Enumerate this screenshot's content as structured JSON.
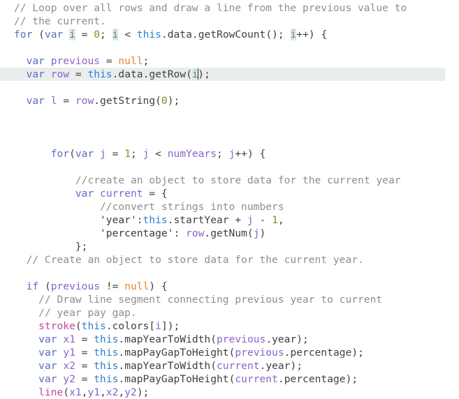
{
  "editor": {
    "name": "code-editor",
    "language": "javascript",
    "background_color": "#ffffff",
    "active_line_color": "#e9edee",
    "occurrence_highlight_color": "#d6efd6",
    "caret_color": "#2b2b2b",
    "active_line_index": 5,
    "caret_line_index": 5,
    "caret_token": "i",
    "syntax_colors": {
      "comment": "#8e8e8e",
      "keyword": "#5c6bc0",
      "this": "#2f7fd1",
      "variable": "#8b63c9",
      "number": "#8a8a1f",
      "null": "#e08a35",
      "builtin_function": "#c14aa0",
      "identifier": "#3f3f3f",
      "string": "#3a3a3a"
    }
  },
  "code": {
    "lines": [
      "// Loop over all rows and draw a line from the previous value to",
      "// the current.",
      "for (var i = 0; i < this.data.getRowCount(); i++) {",
      "",
      "  var previous = null;",
      "  var row = this.data.getRow(i);",
      "",
      "  var l = row.getString(0);",
      "",
      "",
      "",
      "      for(var j = 1; j < numYears; j++) {",
      "",
      "          //create an object to store data for the current year",
      "          var current = {",
      "              //convert strings into numbers",
      "              'year':this.startYear + j - 1,",
      "              'percentage': row.getNum(j)",
      "          };",
      "  // Create an object to store data for the current year.",
      "",
      "  if (previous != null) {",
      "    // Draw line segment connecting previous year to current",
      "    // year pay gap.",
      "    stroke(this.colors[i]);",
      "    var x1 = this.mapYearToWidth(previous.year);",
      "    var y1 = this.mapPayGapToHeight(previous.percentage);",
      "    var x2 = this.mapYearToWidth(current.year);",
      "    var y2 = this.mapPayGapToHeight(current.percentage);",
      "    line(x1,y1,x2,y2);"
    ],
    "tokens": {
      "comment_1": "// Loop over all rows and draw a line from the previous value to",
      "comment_2": "// the current.",
      "comment_3": "//create an object to store data for the current year",
      "comment_4": "//convert strings into numbers",
      "comment_5": "// Create an object to store data for the current year.",
      "comment_6": "// Draw line segment connecting previous year to current",
      "comment_7": "// year pay gap.",
      "keyword_for": "for",
      "keyword_var": "var",
      "keyword_if": "if",
      "keyword_this": "this",
      "literal_null": "null",
      "number_zero": "0",
      "number_one": "1",
      "builtin_stroke": "stroke",
      "builtin_line": "line",
      "identifier_data": "data",
      "identifier_getRowCount": "getRowCount",
      "identifier_getRow": "getRow",
      "identifier_getString": "getString",
      "identifier_getNum": "getNum",
      "identifier_numYears": "numYears",
      "identifier_startYear": "startYear",
      "identifier_colors": "colors",
      "identifier_mapYearToWidth": "mapYearToWidth",
      "identifier_mapPayGapToHeight": "mapPayGapToHeight",
      "variable_i": "i",
      "variable_j": "j",
      "variable_l": "l",
      "variable_row": "row",
      "variable_previous": "previous",
      "variable_current": "current",
      "variable_x1": "x1",
      "variable_y1": "y1",
      "variable_x2": "x2",
      "variable_y2": "y2",
      "string_year": "'year'",
      "string_percentage": "'percentage'",
      "property_year": "year",
      "property_percentage": "percentage"
    }
  }
}
